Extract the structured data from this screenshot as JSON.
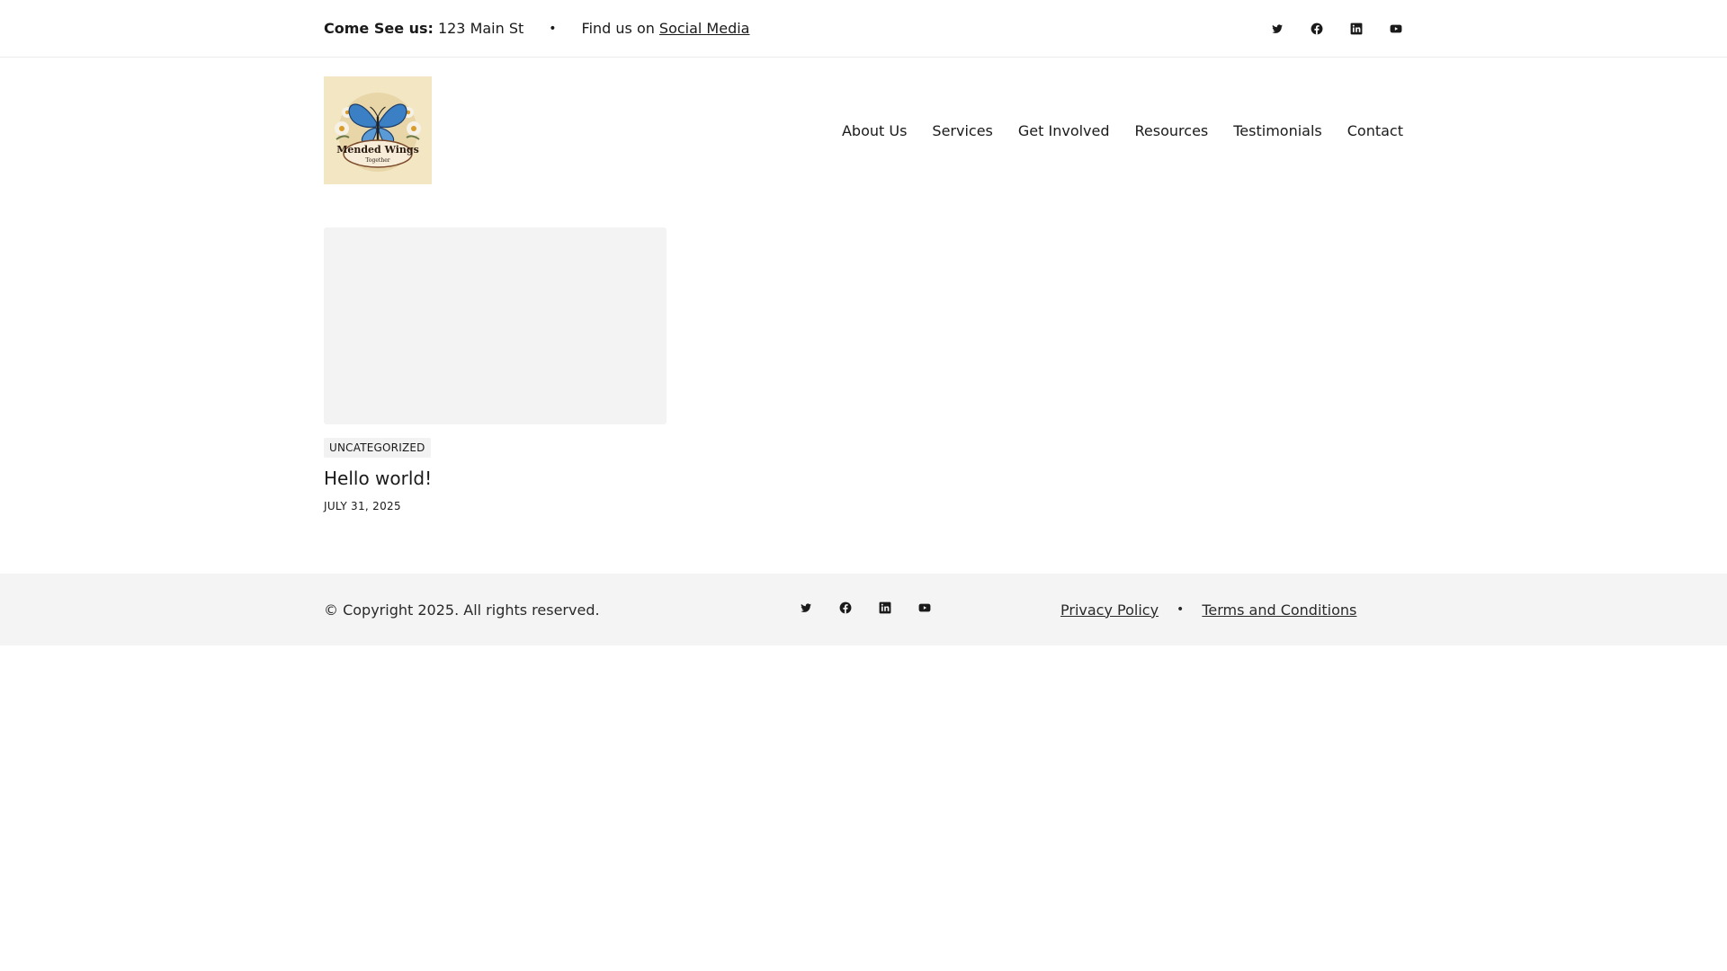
{
  "topbar": {
    "address_label": "Come See us:",
    "address_value": "123 Main St",
    "separator": "•",
    "find_text": "Find us on",
    "find_link": "Social Media",
    "social_icons": [
      "twitter-icon",
      "facebook-icon",
      "linkedin-icon",
      "youtube-icon"
    ]
  },
  "header": {
    "logo_text_main": "Mended Wings",
    "logo_text_sub": "Together",
    "nav": [
      "About Us",
      "Services",
      "Get Involved",
      "Resources",
      "Testimonials",
      "Contact"
    ]
  },
  "post": {
    "category": "UNCATEGORIZED",
    "title": "Hello world!",
    "date": "JULY 31, 2025"
  },
  "footer": {
    "copyright": "© Copyright 2025. All rights reserved.",
    "social_icons": [
      "twitter-icon",
      "facebook-icon",
      "linkedin-icon",
      "youtube-icon"
    ],
    "links": [
      "Privacy Policy",
      "Terms and Conditions"
    ],
    "separator": "•"
  },
  "colors": {
    "text": "#1a1a1a",
    "footer_bg": "#f4f4f4",
    "thumb_bg": "#f3f3f3",
    "logo_bg": "#f3e6c3",
    "butterfly_blue": "#3b7fc4"
  }
}
